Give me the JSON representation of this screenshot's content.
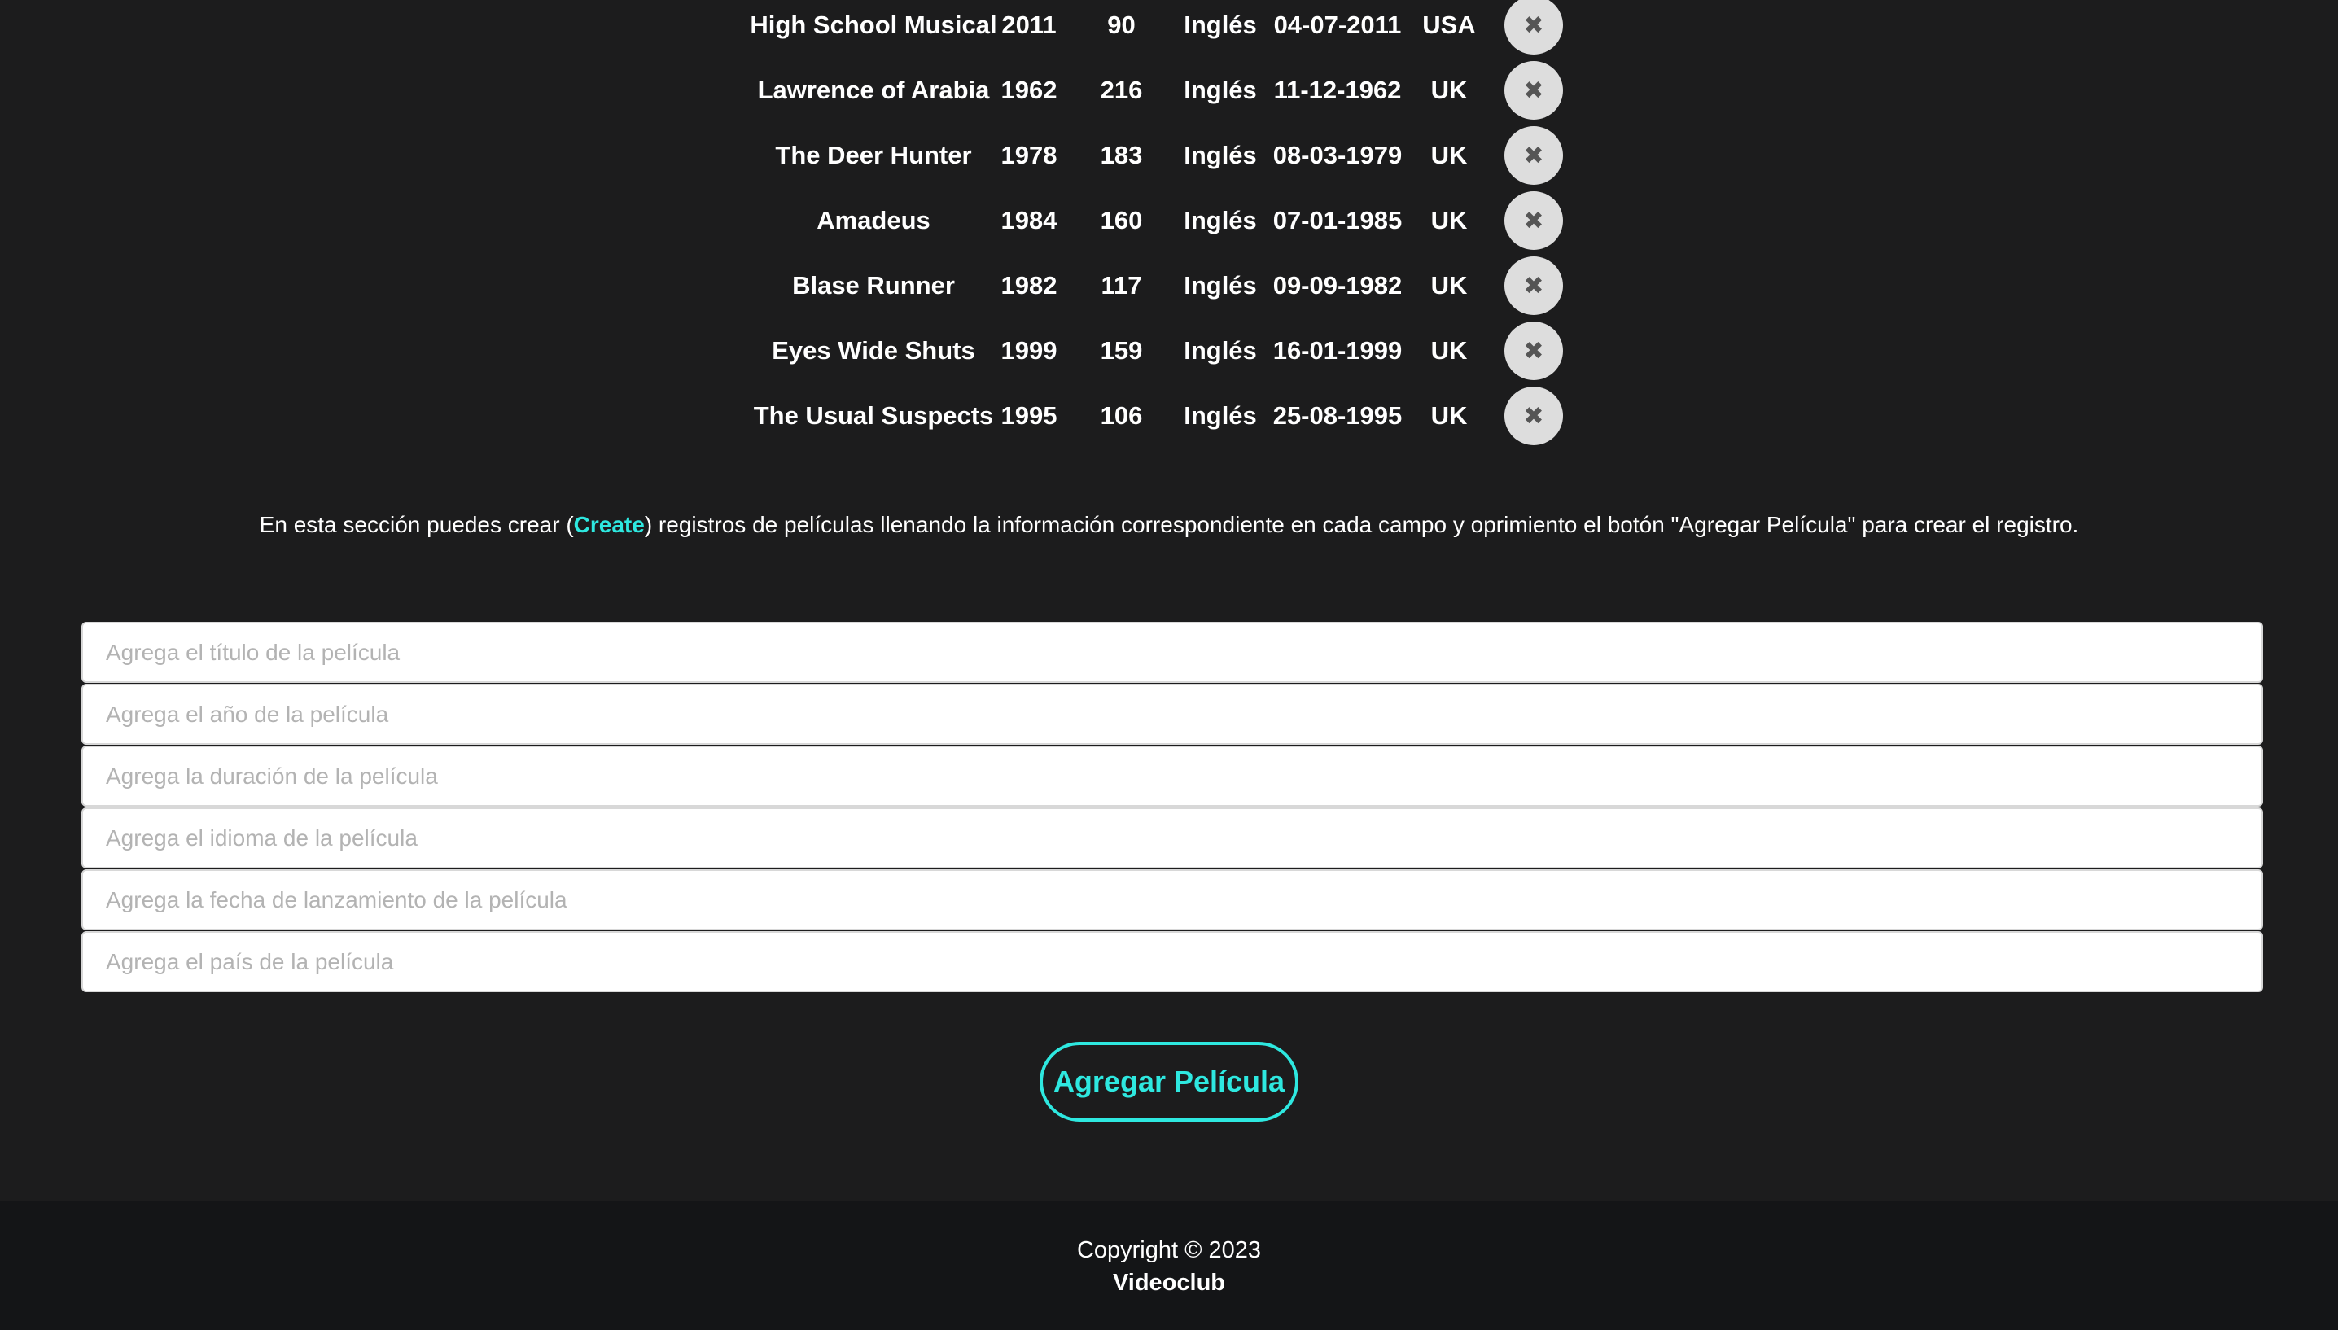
{
  "movies": [
    {
      "title": "High School Musical",
      "year": "2011",
      "duration": "90",
      "language": "Inglés",
      "release_date": "04-07-2011",
      "country": "USA",
      "delete_icon": "✖"
    },
    {
      "title": "Lawrence of Arabia",
      "year": "1962",
      "duration": "216",
      "language": "Inglés",
      "release_date": "11-12-1962",
      "country": "UK",
      "delete_icon": "✖"
    },
    {
      "title": "The Deer Hunter",
      "year": "1978",
      "duration": "183",
      "language": "Inglés",
      "release_date": "08-03-1979",
      "country": "UK",
      "delete_icon": "✖"
    },
    {
      "title": "Amadeus",
      "year": "1984",
      "duration": "160",
      "language": "Inglés",
      "release_date": "07-01-1985",
      "country": "UK",
      "delete_icon": "✖"
    },
    {
      "title": "Blase Runner",
      "year": "1982",
      "duration": "117",
      "language": "Inglés",
      "release_date": "09-09-1982",
      "country": "UK",
      "delete_icon": "✖"
    },
    {
      "title": "Eyes Wide Shuts",
      "year": "1999",
      "duration": "159",
      "language": "Inglés",
      "release_date": "16-01-1999",
      "country": "UK",
      "delete_icon": "✖"
    },
    {
      "title": "The Usual Suspects",
      "year": "1995",
      "duration": "106",
      "language": "Inglés",
      "release_date": "25-08-1995",
      "country": "UK",
      "delete_icon": "✖"
    }
  ],
  "description": {
    "before": "En esta sección puedes crear (",
    "highlight": "Create",
    "after": ") registros de películas llenando la información correspondiente en cada campo y oprimiento el botón \"Agregar Película\" para crear el registro."
  },
  "form": {
    "title_placeholder": "Agrega el título de la película",
    "year_placeholder": "Agrega el año de la película",
    "duration_placeholder": "Agrega la duración de la película",
    "language_placeholder": "Agrega el idioma de la película",
    "release_date_placeholder": "Agrega la fecha de lanzamiento de la película",
    "country_placeholder": "Agrega el país de la película",
    "submit_label": "Agregar Película"
  },
  "footer": {
    "copyright": "Copyright © 2023",
    "brand": "Videoclub"
  },
  "colors": {
    "background": "#1c1c1d",
    "footer_background": "#141517",
    "accent": "#2ee8e0",
    "delete_button": "#dddddd"
  }
}
